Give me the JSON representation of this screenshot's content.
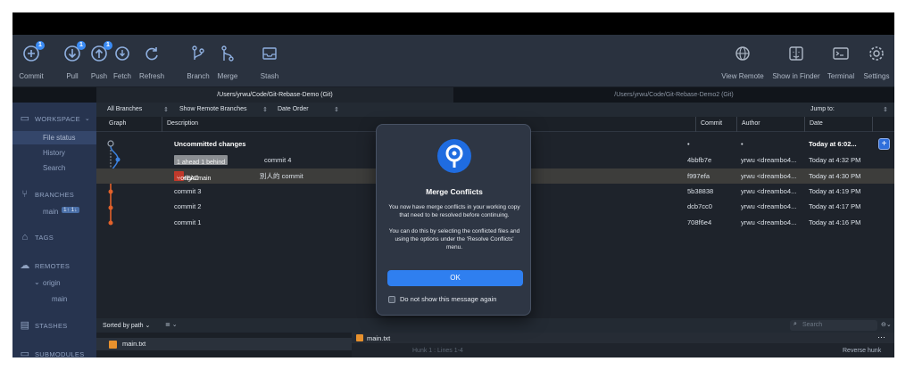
{
  "toolbar": {
    "commit": {
      "label": "Commit",
      "badge": "1"
    },
    "pull": {
      "label": "Pull",
      "badge": "1"
    },
    "push": {
      "label": "Push",
      "badge": "1"
    },
    "fetch": {
      "label": "Fetch"
    },
    "refresh": {
      "label": "Refresh"
    },
    "branch": {
      "label": "Branch"
    },
    "merge": {
      "label": "Merge"
    },
    "stash": {
      "label": "Stash"
    },
    "view_remote": {
      "label": "View Remote"
    },
    "show_in_finder": {
      "label": "Show in Finder"
    },
    "terminal": {
      "label": "Terminal"
    },
    "settings": {
      "label": "Settings"
    }
  },
  "tabs": {
    "active": "/Users/yrwu/Code/Git-Rebase-Demo (Git)",
    "inactive": "/Users/yrwu/Code/Git-Rebase-Demo2 (Git)"
  },
  "sidebar": {
    "workspace": "WORKSPACE",
    "file_status": "File status",
    "history": "History",
    "search": "Search",
    "branches": "BRANCHES",
    "branch_main": "main",
    "branch_main_badge": "1↑ 1↓",
    "tags": "TAGS",
    "remotes": "REMOTES",
    "remote_origin": "origin",
    "remote_main": "main",
    "stashes": "STASHES",
    "submodules": "SUBMODULES"
  },
  "filter": {
    "branches": "All Branches",
    "remote": "Show Remote Branches",
    "order": "Date Order",
    "jump": "Jump to:"
  },
  "columns": {
    "graph": "Graph",
    "description": "Description",
    "commit": "Commit",
    "author": "Author",
    "date": "Date"
  },
  "rows": [
    {
      "desc": "Uncommitted changes",
      "commit": "•",
      "author": "•",
      "date": "Today at 6:02..."
    },
    {
      "tag_main": "main",
      "tag_ahead": "1 ahead 1 behind",
      "desc": "commit 4",
      "commit": "4bbfb7e",
      "author": "yrwu <dreambo4...",
      "date": "Today at 4:32 PM"
    },
    {
      "tag_head": "HEAD",
      "tag_origin": "origin/main",
      "desc": "別人的 commit",
      "commit": "f997efa",
      "author": "yrwu <dreambo4...",
      "date": "Today at 4:30 PM"
    },
    {
      "desc": "commit 3",
      "commit": "5b38838",
      "author": "yrwu <dreambo4...",
      "date": "Today at 4:19 PM"
    },
    {
      "desc": "commit 2",
      "commit": "dcb7cc0",
      "author": "yrwu <dreambo4...",
      "date": "Today at 4:17 PM"
    },
    {
      "desc": "commit 1",
      "commit": "708f6e4",
      "author": "yrwu <dreambo4...",
      "date": "Today at 4:16 PM"
    }
  ],
  "bottom": {
    "sort": "Sorted by path",
    "search_placeholder": "Search",
    "file": "main.txt",
    "diff_file": "main.txt",
    "hunk": "Hunk 1 : Lines 1-4",
    "reverse_hunk": "Reverse hunk"
  },
  "modal": {
    "title": "Merge Conflicts",
    "message1": "You now have merge conflicts in your working copy that need to be resolved before continuing.",
    "message2": "You can do this by selecting the conflicted files and using the options under the 'Resolve Conflicts' menu.",
    "ok": "OK",
    "checkbox": "Do not show this message again"
  },
  "colors": {
    "accent": "#2f7ff0",
    "sidebar": "#27344f",
    "branch_tag": "#3a6fd8",
    "head_tag": "#c0392b",
    "graph_orange": "#e2612a"
  }
}
